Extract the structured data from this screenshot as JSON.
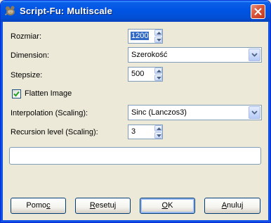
{
  "window": {
    "title": "Script-Fu: Multiscale"
  },
  "form": {
    "rozmiar": {
      "label": "Rozmiar:",
      "value": "1200"
    },
    "dimension": {
      "label": "Dimension:",
      "selected": "Szerokość"
    },
    "stepsize": {
      "label": "Stepsize:",
      "value": "500"
    },
    "flatten": {
      "label": "Flatten Image",
      "checked": true
    },
    "interpolation": {
      "label": "Interpolation (Scaling):",
      "selected": "Sinc (Lanczos3)"
    },
    "recursion": {
      "label": "Recursion level (Scaling):",
      "value": "3"
    }
  },
  "progress": {
    "value": 0
  },
  "buttons": {
    "help": {
      "pre": "Pomo",
      "mnemonic": "c",
      "post": ""
    },
    "reset": {
      "pre": "",
      "mnemonic": "R",
      "post": "esetuj"
    },
    "ok": {
      "pre": "",
      "mnemonic": "O",
      "post": "K"
    },
    "cancel": {
      "pre": "",
      "mnemonic": "A",
      "post": "nuluj"
    }
  },
  "icons": {
    "app": "gimp-wilber-icon",
    "close": "close-x-icon",
    "spin_up": "arrow-up-icon",
    "spin_down": "arrow-down-icon",
    "combo": "chevron-down-icon",
    "check": "checkmark-icon"
  },
  "colors": {
    "titlebar": "#0054e3",
    "dialog_bg": "#ece9d8",
    "selection": "#316ac5",
    "close_button": "#d8553a",
    "checkmark": "#21a121"
  }
}
